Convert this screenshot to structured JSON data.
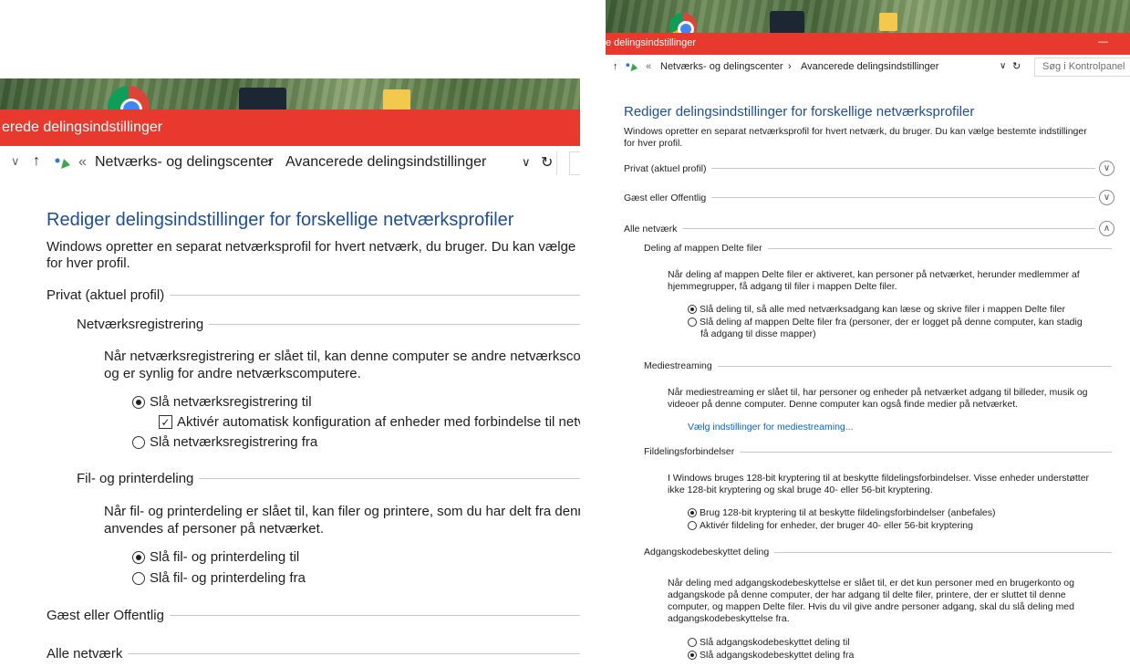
{
  "left": {
    "window_title": "erede delingsindstillinger",
    "breadcrumb": {
      "overflow": "«",
      "item1": "Netværks- og delingscenter",
      "separator": "›",
      "item2": "Avancerede delingsindstillinger"
    },
    "heading": "Rediger delingsindstillinger for forskellige netværksprofiler",
    "intro_line1": "Windows opretter en separat netværksprofil for hvert netværk, du bruger. Du kan vælge bes",
    "intro_line2": "for hver profil.",
    "profile_private": "Privat (aktuel profil)",
    "network_discovery": {
      "title": "Netværksregistrering",
      "desc_line1": "Når netværksregistrering er slået til, kan denne computer se andre netværkscomp",
      "desc_line2": "og er synlig for andre netværkscomputere.",
      "option_on": "Slå netværksregistrering til",
      "auto_config": "Aktivér automatisk konfiguration af enheder med forbindelse til netvæ",
      "option_off": "Slå netværksregistrering fra"
    },
    "file_printer": {
      "title": "Fil- og printerdeling",
      "desc_line1": "Når fil- og printerdeling er slået til, kan filer og printere, som du har delt fra denne",
      "desc_line2": "anvendes af personer på netværket.",
      "option_on": "Slå fil- og printerdeling til",
      "option_off": "Slå fil- og printerdeling fra"
    },
    "profile_guest": "Gæst eller Offentlig",
    "profile_all": "Alle netværk"
  },
  "right": {
    "window_title": "e delingsindstillinger",
    "minimize": "—",
    "breadcrumb": {
      "overflow": "«",
      "item1": "Netværks- og delingscenter",
      "separator": "›",
      "item2": "Avancerede delingsindstillinger"
    },
    "search_placeholder": "Søg i Kontrolpanel",
    "heading": "Rediger delingsindstillinger for forskellige netværksprofiler",
    "intro_line1": "Windows opretter en separat netværksprofil for hvert netværk, du bruger. Du kan vælge bestemte indstillinger",
    "intro_line2": "for hver profil.",
    "profile_private": "Privat (aktuel profil)",
    "profile_guest": "Gæst eller Offentlig",
    "profile_all": "Alle netværk",
    "public_folder": {
      "title": "Deling af mappen Delte filer",
      "desc_line1": "Når deling af mappen Delte filer er aktiveret, kan personer på netværket, herunder medlemmer af",
      "desc_line2": "hjemmegrupper, få adgang til filer i mappen Delte filer.",
      "option_on": "Slå deling til, så alle med netværksadgang kan læse og skrive filer i mappen Delte filer",
      "option_off_line1": "Slå deling af mappen Delte filer fra (personer, der er logget på denne computer, kan stadig",
      "option_off_line2": "få adgang til disse mapper)"
    },
    "media": {
      "title": "Mediestreaming",
      "desc_line1": "Når mediestreaming er slået til, har personer og enheder på netværket adgang til billeder, musik og",
      "desc_line2": "videoer på denne computer. Denne computer kan også finde medier på netværket.",
      "link": "Vælg indstillinger for mediestreaming..."
    },
    "file_connections": {
      "title": "Fildelingsforbindelser",
      "desc_line1": "I Windows bruges 128-bit kryptering til at beskytte fildelingsforbindelser. Visse enheder understøtter",
      "desc_line2": "ikke 128-bit kryptering og skal bruge 40- eller 56-bit kryptering.",
      "option_128": "Brug 128-bit kryptering til at beskytte fildelingsforbindelser (anbefales)",
      "option_40": "Aktivér fildeling for enheder, der bruger 40- eller 56-bit kryptering"
    },
    "password": {
      "title": "Adgangskodebeskyttet deling",
      "desc_line1": "Når deling med adgangskodebeskyttelse er slået til, er det kun personer med en brugerkonto og",
      "desc_line2": "adgangskode på denne computer, der har adgang til delte filer, printere, der er sluttet til denne",
      "desc_line3": "computer, og mappen Delte filer. Hvis du vil give andre personer adgang, skal du slå deling med",
      "desc_line4": "adgangskodebeskyttelse fra.",
      "option_on": "Slå adgangskodebeskyttet deling til",
      "option_off": "Slå adgangskodebeskyttet deling fra"
    }
  },
  "icons": {
    "up": "↑",
    "down_chevron": "∨",
    "refresh": "↻",
    "expand": "∨",
    "collapse": "∧",
    "check": "✓"
  },
  "colors": {
    "titlebar": "#e8392e",
    "heading": "#1e4e9a",
    "link": "#0066cc"
  }
}
